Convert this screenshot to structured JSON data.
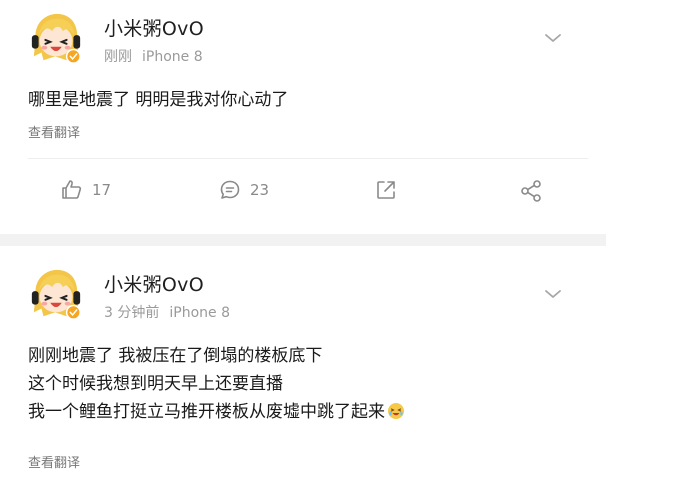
{
  "posts": [
    {
      "username": "小米粥OvO",
      "time": "刚刚",
      "device": "iPhone 8",
      "lines": [
        "哪里是地震了 明明是我对你心动了"
      ],
      "translate_label": "查看翻译",
      "actions": {
        "likes": "17",
        "comments": "23"
      }
    },
    {
      "username": "小米粥OvO",
      "time": "3 分钟前",
      "device": "iPhone 8",
      "lines": [
        "刚刚地震了 我被压在了倒塌的楼板底下",
        "这个时候我想到明天早上还要直播",
        "我一个鲤鱼打挺立马推开楼板从废墟中跳了起来"
      ],
      "translate_label": "查看翻译"
    }
  ],
  "icons": {
    "like": "thumbs-up-icon",
    "comment": "comment-bubble-icon",
    "share": "share-arrow-icon",
    "more": "share-nodes-icon",
    "menu": "chevron-down-icon",
    "emoji": "laughing-emoji-icon",
    "badge": "verified-badge-icon"
  },
  "colors": {
    "badge": "#f5a623",
    "meta": "#9a9a9a",
    "separator": "#f2f2f2"
  }
}
